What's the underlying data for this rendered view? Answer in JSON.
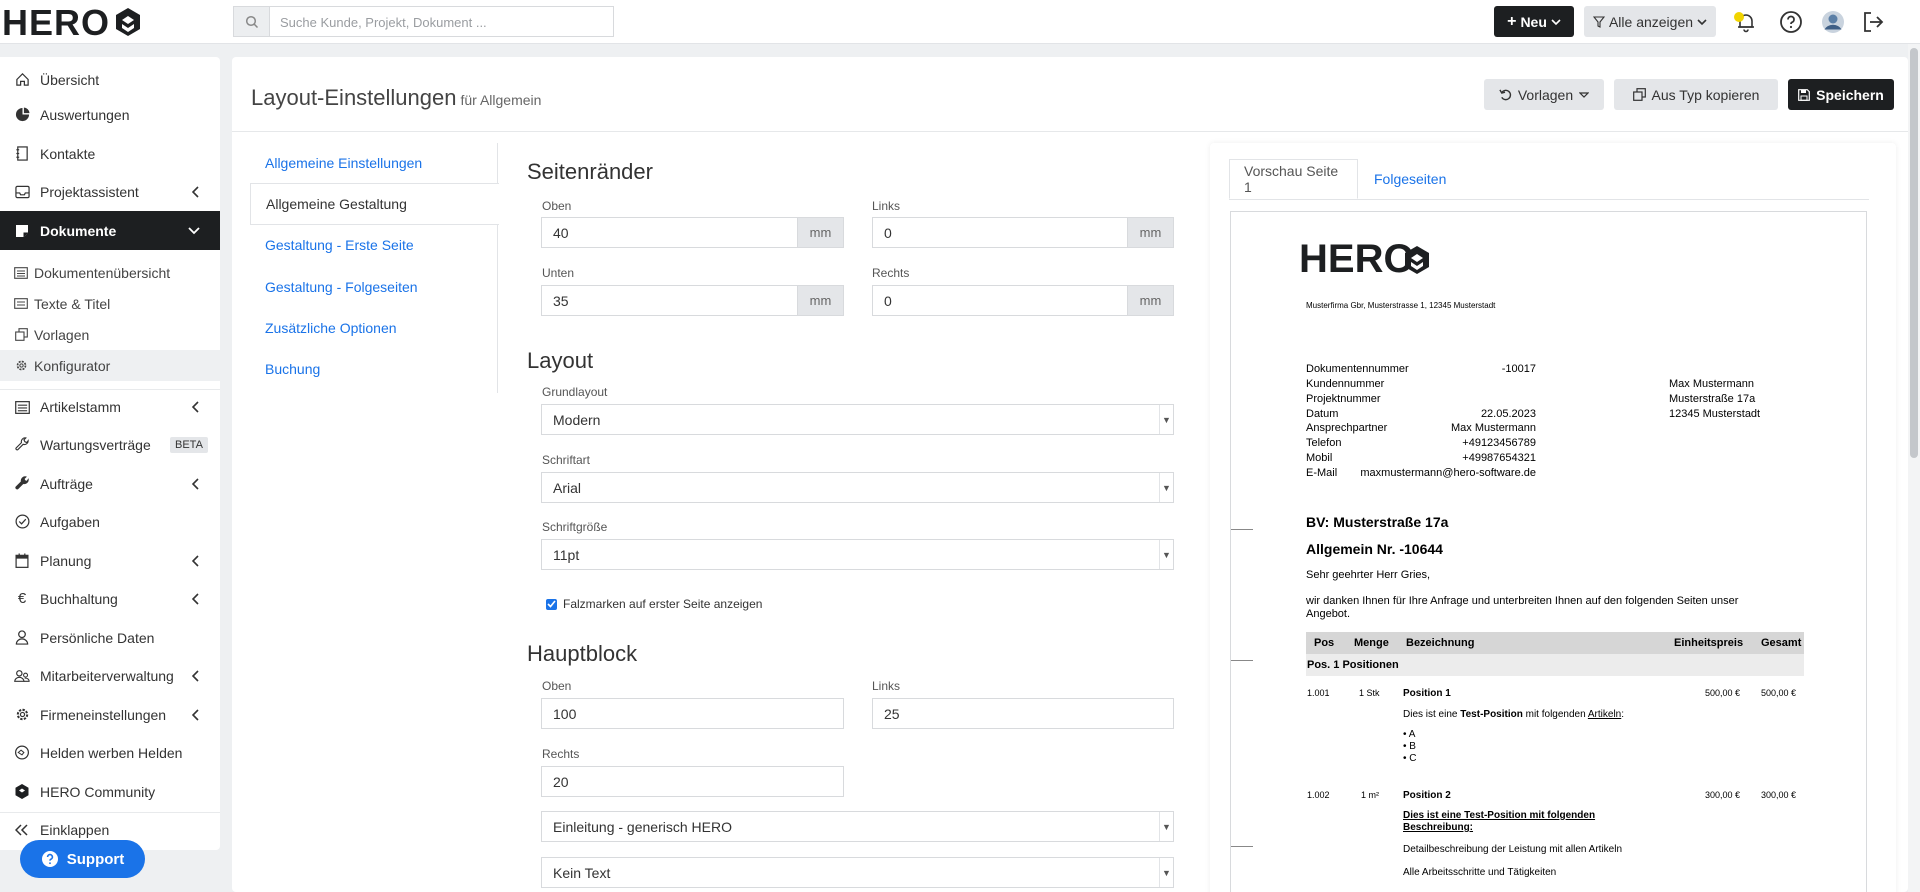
{
  "topbar": {
    "logo_text": "HERO",
    "search_placeholder": "Suche Kunde, Projekt, Dokument ...",
    "new_button": "Neu",
    "filter_button": "Alle anzeigen"
  },
  "sidebar": {
    "items": [
      {
        "label": "Übersicht",
        "icon": "home-icon"
      },
      {
        "label": "Auswertungen",
        "icon": "pie-chart-icon"
      },
      {
        "label": "Kontakte",
        "icon": "address-book-icon"
      },
      {
        "label": "Projektassistent",
        "icon": "inbox-icon"
      },
      {
        "label": "Dokumente",
        "icon": "document-icon"
      },
      {
        "label": "Artikelstamm",
        "icon": "list-icon"
      },
      {
        "label": "Wartungsverträge",
        "icon": "wrench-icon",
        "badge": "BETA"
      },
      {
        "label": "Aufträge",
        "icon": "tool-icon"
      },
      {
        "label": "Aufgaben",
        "icon": "check-circle-icon"
      },
      {
        "label": "Planung",
        "icon": "calendar-icon"
      },
      {
        "label": "Buchhaltung",
        "icon": "euro-icon"
      },
      {
        "label": "Persönliche Daten",
        "icon": "user-icon"
      },
      {
        "label": "Mitarbeiterverwaltung",
        "icon": "users-icon"
      },
      {
        "label": "Firmeneinstellungen",
        "icon": "gear-icon"
      },
      {
        "label": "Helden werben Helden",
        "icon": "handshake-icon"
      },
      {
        "label": "HERO Community",
        "icon": "hero-logo-icon"
      },
      {
        "label": "Einklappen",
        "icon": "double-chevron-left-icon"
      }
    ],
    "sub_items": [
      {
        "label": "Dokumentenübersicht"
      },
      {
        "label": "Texte & Titel"
      },
      {
        "label": "Vorlagen"
      },
      {
        "label": "Konfigurator"
      }
    ],
    "support_label": "Support"
  },
  "header": {
    "title": "Layout-Einstellungen",
    "subtitle": "für Allgemein",
    "templates_button": "Vorlagen",
    "copy_button": "Aus Typ kopieren",
    "save_button": "Speichern"
  },
  "settings_nav": [
    "Allgemeine Einstellungen",
    "Allgemeine Gestaltung",
    "Gestaltung - Erste Seite",
    "Gestaltung - Folgeseiten",
    "Zusätzliche Optionen",
    "Buchung"
  ],
  "form": {
    "margins": {
      "title": "Seitenränder",
      "top_label": "Oben",
      "top_value": "40",
      "left_label": "Links",
      "left_value": "0",
      "bottom_label": "Unten",
      "bottom_value": "35",
      "right_label": "Rechts",
      "right_value": "0",
      "unit": "mm"
    },
    "layout": {
      "title": "Layout",
      "base_label": "Grundlayout",
      "base_value": "Modern",
      "font_label": "Schriftart",
      "font_value": "Arial",
      "size_label": "Schriftgröße",
      "size_value": "11pt",
      "fold_marks_label": "Falzmarken auf erster Seite anzeigen",
      "fold_marks_checked": true
    },
    "main_block": {
      "title": "Hauptblock",
      "top_label": "Oben",
      "top_value": "100",
      "left_label": "Links",
      "left_value": "25",
      "right_label": "Rechts",
      "right_value": "20",
      "intro_select": "Einleitung - generisch HERO",
      "text_select": "Kein Text"
    }
  },
  "preview": {
    "tab_first": "Vorschau Seite 1",
    "tab_following": "Folgeseiten",
    "doc": {
      "logo": "HERO",
      "sender_line": "Musterfirma Gbr, Musterstrasse 1, 12345 Musterstadt",
      "meta_labels": [
        "Dokumentennummer",
        "Kundennummer",
        "Projektnummer",
        "Datum",
        "Ansprechpartner",
        "Telefon",
        "Mobil",
        "E-Mail"
      ],
      "meta_values": [
        "-10017",
        "",
        "",
        "22.05.2023",
        "Max Mustermann",
        "+49123456789",
        "+49987654321",
        "maxmustermann@hero-software.de"
      ],
      "recipient": [
        "Max Mustermann",
        "Musterstraße 17a",
        "12345 Musterstadt"
      ],
      "bv": "BV: Musterstraße 17a",
      "doc_title": "Allgemein Nr. -10644",
      "salutation": "Sehr geehrter Herr Gries,",
      "intro_1": "wir danken Ihnen für Ihre Anfrage und unterbreiten Ihnen auf den folgenden Seiten unser",
      "intro_2": "Angebot.",
      "table_headers": [
        "Pos",
        "Menge",
        "Bezeichnung",
        "Einheitspreis",
        "Gesamt"
      ],
      "group_row": "Pos. 1  Positionen",
      "row1": {
        "pos": "1.001",
        "qty": "1 Stk",
        "name": "Position 1",
        "price": "500,00 €",
        "total": "500,00 €"
      },
      "row1_desc_pre": "Dies ist eine ",
      "row1_desc_bold": "Test-Position",
      "row1_desc_mid": " mit folgenden ",
      "row1_desc_ul": "Artikeln",
      "row1_desc_end": ":",
      "row1_bullets": [
        "A",
        "B",
        "C"
      ],
      "row2": {
        "pos": "1.002",
        "qty": "1 m²",
        "name": "Position 2",
        "price": "300,00 €",
        "total": "300,00 €"
      },
      "row2_desc_1": "Dies ist eine Test-Position mit folgenden",
      "row2_desc_2": "Beschreibung:",
      "row2_desc_3": "Detailbeschreibung der Leistung mit allen Artikeln",
      "row2_desc_4": "Alle Arbeitsschritte und Tätigkeiten"
    }
  },
  "colors": {
    "accent_blue": "#1a73e8",
    "dark": "#1d1f21",
    "notification_yellow": "#f1d400"
  }
}
